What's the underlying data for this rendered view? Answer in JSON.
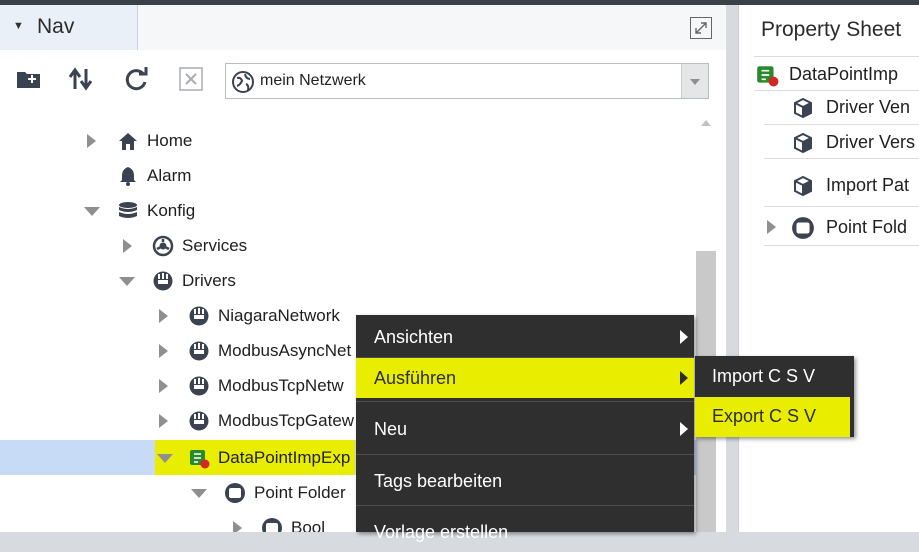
{
  "nav": {
    "title": "Nav",
    "selector_value": "mein Netzwerk",
    "toolbar_icons": [
      "new-folder-icon",
      "sort-icon",
      "refresh-icon",
      "close-icon"
    ]
  },
  "tree": [
    {
      "label": "Home",
      "icon": "home-icon"
    },
    {
      "label": "Alarm",
      "icon": "bell-icon"
    },
    {
      "label": "Konfig",
      "icon": "database-icon"
    },
    {
      "label": "Services",
      "icon": "services-icon"
    },
    {
      "label": "Drivers",
      "icon": "drivers-icon"
    },
    {
      "label": "NiagaraNetwork",
      "icon": "network-icon"
    },
    {
      "label": "ModbusAsyncNet",
      "icon": "network-icon"
    },
    {
      "label": "ModbusTcpNetw",
      "icon": "network-icon"
    },
    {
      "label": "ModbusTcpGatew",
      "icon": "network-icon"
    },
    {
      "label": "DataPointImpExp",
      "icon": "datapoint-icon"
    },
    {
      "label": "Point Folder",
      "icon": "folder-icon"
    },
    {
      "label": "Bool",
      "icon": "folder-icon"
    }
  ],
  "property_sheet": {
    "title": "Property Sheet",
    "root_label": "DataPointImp",
    "rows": [
      {
        "label": "Driver Ven",
        "icon": "cube-icon"
      },
      {
        "label": "Driver Vers",
        "icon": "cube-icon"
      },
      {
        "label": "Import Pat",
        "icon": "cube-icon"
      },
      {
        "label": "Point Fold",
        "icon": "folder-icon"
      }
    ]
  },
  "context_menu": {
    "items": [
      {
        "label": "Ansichten"
      },
      {
        "label": "Ausführen"
      },
      {
        "label": "Neu"
      },
      {
        "label": "Tags bearbeiten"
      },
      {
        "label": "Vorlage erstellen"
      }
    ],
    "submenu": [
      {
        "label": "Import C S V"
      },
      {
        "label": "Export C S V"
      }
    ]
  },
  "colors": {
    "highlight": "#e9ee00",
    "menu_bg": "#2f2f2f",
    "selection": "#c7daf6"
  }
}
